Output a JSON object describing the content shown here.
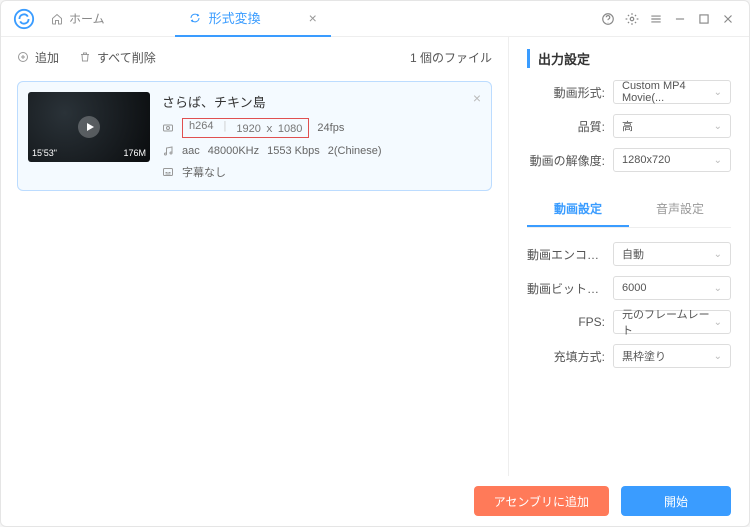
{
  "titlebar": {
    "home_label": "ホーム",
    "tab_label": "形式変換"
  },
  "toolbar": {
    "add_label": "追加",
    "clear_label": "すべて削除",
    "file_count": "1 個のファイル"
  },
  "file": {
    "title": "さらば、チキン島",
    "video_codec": "h264",
    "resolution": "1920 ｘ 1080",
    "fps": "24fps",
    "audio_codec": "aac",
    "sample_rate": "48000KHz",
    "bitrate": "1553 Kbps",
    "audio_lang": "2(Chinese)",
    "subtitle": "字幕なし",
    "duration": "15'53\"",
    "size": "176M"
  },
  "output": {
    "section_title": "出力設定",
    "format_label": "動画形式:",
    "format_value": "Custom MP4 Movie(...",
    "quality_label": "品質:",
    "quality_value": "高",
    "resolution_label": "動画の解像度:",
    "resolution_value": "1280x720"
  },
  "subtabs": {
    "video": "動画設定",
    "audio": "音声設定"
  },
  "video_settings": {
    "encoder_label": "動画エンコーダ:",
    "encoder_value": "自動",
    "bitrate_label": "動画ビットレー...",
    "bitrate_value": "6000",
    "fps_label": "FPS:",
    "fps_value": "元のフレームレート",
    "fill_label": "充填方式:",
    "fill_value": "黒枠塗り"
  },
  "footer": {
    "assembly": "アセンブリに追加",
    "start": "開始"
  }
}
